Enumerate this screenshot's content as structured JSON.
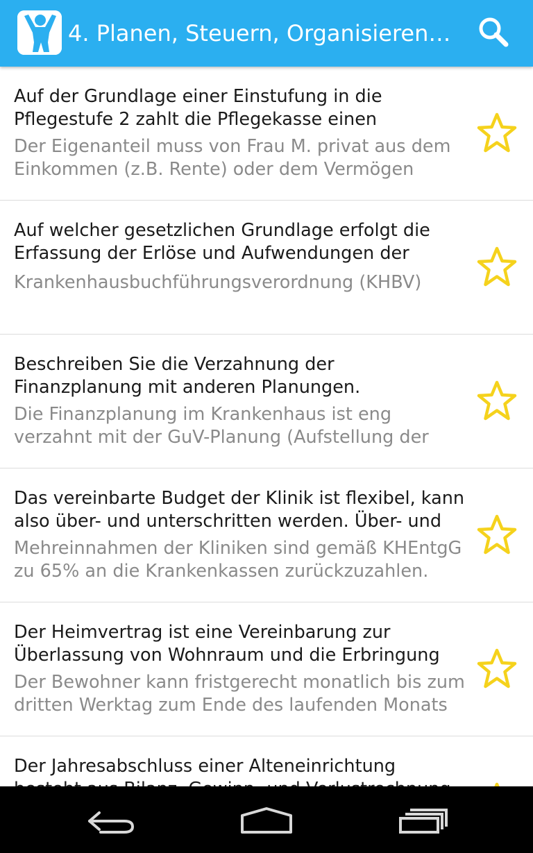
{
  "header": {
    "title": "4. Planen, Steuern, Organisieren…",
    "app_icon": "person-arms-up-icon",
    "search_icon": "search-icon",
    "accent_color": "#2baff0"
  },
  "items": [
    {
      "title": "Auf der Grundlage einer Einstufung in die Pflegestufe 2 zahlt die Pflegekasse einen",
      "subtitle": "Der Eigenanteil muss von Frau M. privat aus dem Einkommen (z.B. Rente) oder dem Vermögen",
      "icon": "star-outline-icon"
    },
    {
      "title": "Auf welcher gesetzlichen Grundlage erfolgt die Erfassung der Erlöse und Aufwendungen der",
      "subtitle": "Krankenhausbuchführungsverordnung (KHBV)",
      "icon": "star-outline-icon"
    },
    {
      "title": "Beschreiben Sie die Verzahnung der Finanzplanung mit anderen Planungen.",
      "subtitle": "Die Finanzplanung im Krankenhaus ist eng verzahnt mit der GuV-Planung (Aufstellung der",
      "icon": "star-outline-icon"
    },
    {
      "title": "Das vereinbarte Budget der Klinik ist flexibel, kann also über- und unterschritten werden. Über- und",
      "subtitle": "Mehreinnahmen der Kliniken sind gemäß KHEntgG zu 65% an die Krankenkassen zurückzuzahlen.",
      "icon": "star-outline-icon"
    },
    {
      "title": "Der Heimvertrag ist eine Vereinbarung zur Überlassung von Wohnraum und die Erbringung",
      "subtitle": "Der Bewohner kann fristgerecht monatlich bis zum dritten Werktag zum Ende des laufenden Monats",
      "icon": "star-outline-icon"
    },
    {
      "title": "Der Jahresabschluss einer Alteneinrichtung besteht aus Bilanz, Gewinn- und Verlustrechnung",
      "subtitle": "",
      "icon": "star-outline-icon"
    }
  ],
  "star_color": "#f5d21c",
  "nav": {
    "back_icon": "back-arrow-icon",
    "home_icon": "home-icon",
    "recents_icon": "recent-apps-icon"
  }
}
